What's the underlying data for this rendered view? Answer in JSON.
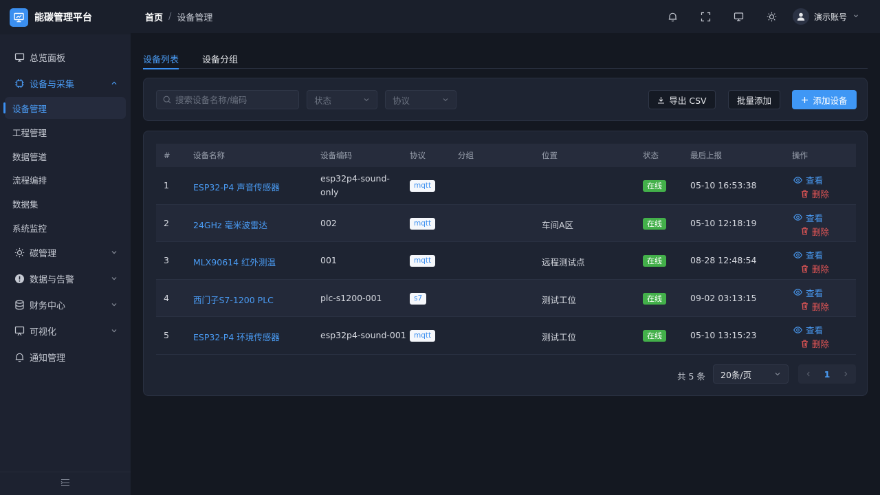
{
  "app": {
    "title": "能碳管理平台"
  },
  "sidebar": {
    "items": [
      {
        "label": "总览面板",
        "icon": "monitor-icon"
      },
      {
        "label": "设备与采集",
        "icon": "chip-icon",
        "expanded": true
      },
      {
        "label": "碳管理",
        "icon": "sun-icon"
      },
      {
        "label": "数据与告警",
        "icon": "alert-icon"
      },
      {
        "label": "财务中心",
        "icon": "database-icon"
      },
      {
        "label": "可视化",
        "icon": "board-icon"
      },
      {
        "label": "通知管理",
        "icon": "bell-icon"
      }
    ],
    "sub_items": [
      "设备管理",
      "工程管理",
      "数据管道",
      "流程编排",
      "数据集",
      "系统监控"
    ],
    "active_sub": "设备管理"
  },
  "header": {
    "breadcrumb_home": "首页",
    "breadcrumb_sep": "/",
    "breadcrumb_current": "设备管理",
    "icons": [
      "bell-icon",
      "fullscreen-icon",
      "monitor-icon",
      "sun-icon"
    ],
    "user_name": "演示账号"
  },
  "tabs": [
    {
      "label": "设备列表",
      "active": true
    },
    {
      "label": "设备分组",
      "active": false
    }
  ],
  "filters": {
    "search_placeholder": "搜索设备名称/编码",
    "status_placeholder": "状态",
    "protocol_placeholder": "协议",
    "export_label": "导出 CSV",
    "batch_add_label": "批量添加",
    "add_label": "添加设备"
  },
  "table": {
    "headers": [
      "#",
      "设备名称",
      "设备编码",
      "协议",
      "分组",
      "位置",
      "状态",
      "最后上报",
      "操作"
    ],
    "rows": [
      {
        "idx": "1",
        "name": "ESP32-P4 声音传感器",
        "code_l1": "esp32p4-sound-",
        "code_l2": "only",
        "protocol": "mqtt",
        "group": "",
        "location": "",
        "status": "在线",
        "last": "05-10 16:53:38",
        "view": "查看",
        "del": "删除"
      },
      {
        "idx": "2",
        "name": "24GHz 毫米波雷达",
        "code_l1": "002",
        "code_l2": "",
        "protocol": "mqtt",
        "group": "",
        "location": "车间A区",
        "status": "在线",
        "last": "05-10 12:18:19",
        "view": "查看",
        "del": "删除"
      },
      {
        "idx": "3",
        "name": "MLX90614 红外测温",
        "code_l1": "001",
        "code_l2": "",
        "protocol": "mqtt",
        "group": "",
        "location": "远程测试点",
        "status": "在线",
        "last": "08-28 12:48:54",
        "view": "查看",
        "del": "删除"
      },
      {
        "idx": "4",
        "name": "西门子S7-1200 PLC",
        "code_l1": "plc-s1200-001",
        "code_l2": "",
        "protocol": "s7",
        "group": "",
        "location": "测试工位",
        "status": "在线",
        "last": "09-02 03:13:15",
        "view": "查看",
        "del": "删除"
      },
      {
        "idx": "5",
        "name": "ESP32-P4 环境传感器",
        "code_l1": "esp32p4-sound-001",
        "code_l2": "",
        "protocol": "mqtt",
        "group": "",
        "location": "测试工位",
        "status": "在线",
        "last": "05-10 13:15:23",
        "view": "查看",
        "del": "删除"
      }
    ]
  },
  "pagination": {
    "total_text": "共 5 条",
    "page_size": "20条/页",
    "current_page": "1"
  },
  "colors": {
    "accent": "#3f97f5",
    "online": "#43b04a",
    "danger": "#e05555",
    "background": "#141821",
    "sidebar": "#1d2230"
  }
}
